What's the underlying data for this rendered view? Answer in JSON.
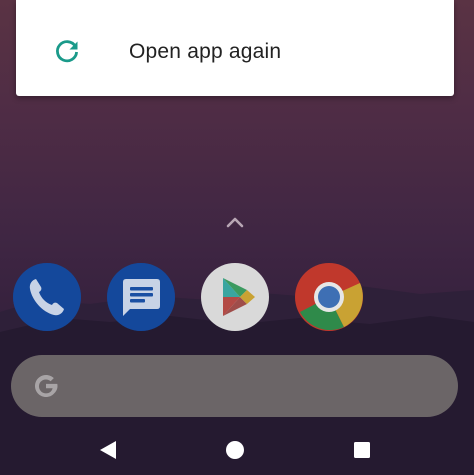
{
  "dialog": {
    "icon": "refresh-icon",
    "label": "Open app again",
    "accent_color": "#1a9a8a"
  },
  "launcher": {
    "swipe_up_icon": "chevron-up-icon",
    "apps": [
      {
        "name": "phone",
        "icon": "phone-icon",
        "color": "#1a4fa3"
      },
      {
        "name": "messages",
        "icon": "messages-icon",
        "color": "#1a4fa3"
      },
      {
        "name": "play-store",
        "icon": "play-store-icon",
        "color": "#d9d9d9"
      },
      {
        "name": "chrome",
        "icon": "chrome-icon",
        "color": "#c0382c"
      }
    ]
  },
  "search": {
    "icon": "google-g-icon"
  },
  "nav": {
    "back_icon": "back-triangle-icon",
    "home_icon": "home-circle-icon",
    "recents_icon": "recents-square-icon"
  }
}
